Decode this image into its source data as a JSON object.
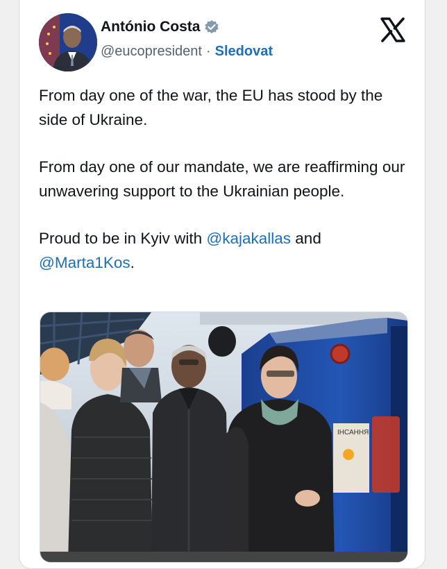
{
  "author": {
    "name": "António Costa",
    "handle": "@eucopresident",
    "separator": "·",
    "follow_label": "Sledovat"
  },
  "tweet": {
    "paragraph1": "From day one of the war, the EU has stood by the side of Ukraine.",
    "paragraph2": "From day one of our mandate, we are reaffirming our unwavering support to the Ukrainian people.",
    "paragraph3_prefix": "Proud to be in Kyiv with",
    "mention1": "@kajakallas",
    "and_word": "and",
    "mention2": "@Marta1Kos",
    "period": "."
  },
  "photo": {
    "train_sign": "ІНСАННЯ"
  },
  "colors": {
    "link": "#1d6fb8",
    "verified": "#829aab",
    "train": "#1f4fa8"
  },
  "icons": {
    "verified": "verified-badge-icon",
    "brand": "x-logo-icon"
  }
}
